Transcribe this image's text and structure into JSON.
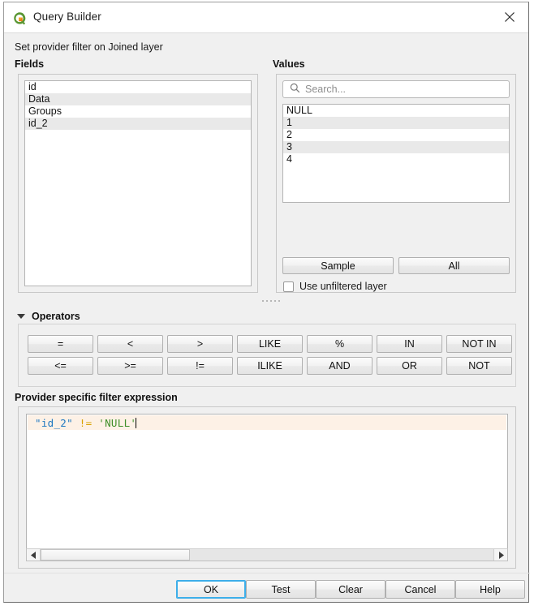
{
  "window": {
    "title": "Query Builder",
    "icon": "qgis-logo-icon",
    "close_icon": "close-icon"
  },
  "subtitle": "Set provider filter on Joined layer",
  "fields": {
    "label": "Fields",
    "items": [
      {
        "name": "id"
      },
      {
        "name": "Data"
      },
      {
        "name": "Groups"
      },
      {
        "name": "id_2"
      }
    ]
  },
  "values": {
    "label": "Values",
    "search": {
      "placeholder": "Search...",
      "value": "",
      "icon": "search-icon"
    },
    "items": [
      {
        "name": "NULL"
      },
      {
        "name": "1"
      },
      {
        "name": "2"
      },
      {
        "name": "3"
      },
      {
        "name": "4"
      }
    ],
    "sample_label": "Sample",
    "all_label": "All",
    "unfiltered_label": "Use unfiltered layer",
    "unfiltered_checked": false
  },
  "operators": {
    "label": "Operators",
    "expanded": true,
    "row1": [
      "=",
      "<",
      ">",
      "LIKE",
      "%",
      "IN",
      "NOT IN"
    ],
    "row2": [
      "<=",
      ">=",
      "!=",
      "ILIKE",
      "AND",
      "OR",
      "NOT"
    ]
  },
  "expression": {
    "label": "Provider specific filter expression",
    "tokens": [
      {
        "text": "\"id_2\"",
        "kind": "field"
      },
      {
        "text": " ",
        "kind": "plain"
      },
      {
        "text": "!=",
        "kind": "op"
      },
      {
        "text": " ",
        "kind": "plain"
      },
      {
        "text": "'NULL'",
        "kind": "string"
      }
    ],
    "full_text": "\"id_2\" != 'NULL'"
  },
  "buttons": {
    "ok": "OK",
    "test": "Test",
    "clear": "Clear",
    "cancel": "Cancel",
    "help": "Help"
  },
  "colors": {
    "accent_focus": "#3daee9",
    "field_token": "#1f78c1",
    "operator_token": "#d8a200",
    "string_token": "#3f8f29",
    "current_line": "#fdf1e6",
    "window_bg": "#f0f0f0"
  }
}
